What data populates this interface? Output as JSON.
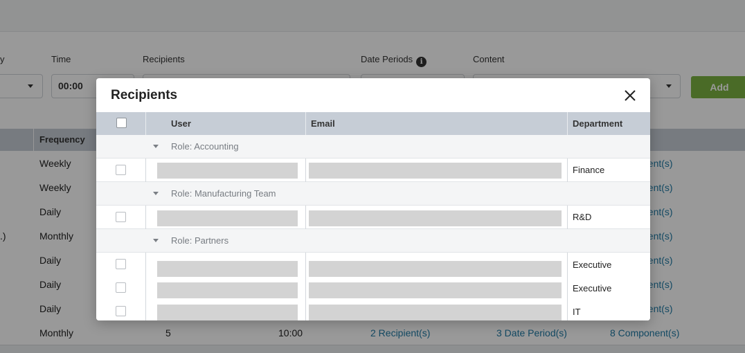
{
  "background": {
    "form": {
      "time_label": "Time",
      "time_value": "00:00",
      "recipients_label": "Recipients",
      "date_periods_label": "Date Periods",
      "info_glyph": "i",
      "content_label": "Content",
      "add_label": "Add"
    },
    "table": {
      "frequency_header": "Frequency",
      "rows": [
        {
          "frequency": "Weekly",
          "components": "nent(s)"
        },
        {
          "frequency": "Weekly",
          "components": "nent(s)"
        },
        {
          "frequency": "Daily",
          "components": "nent(s)"
        },
        {
          "left_fragment": ".)",
          "frequency": "Monthly",
          "components": "nent(s)"
        },
        {
          "frequency": "Daily",
          "components": "nent(s)"
        },
        {
          "frequency": "Daily",
          "components": "nent(s)"
        },
        {
          "frequency": "Daily",
          "components": "nent(s)"
        },
        {
          "frequency": "Monthly",
          "count": "5",
          "time": "10:00",
          "recipients": "2 Recipient(s)",
          "date_periods": "3 Date Period(s)",
          "components": "8 Component(s)"
        }
      ]
    }
  },
  "modal": {
    "title": "Recipients",
    "columns": {
      "user": "User",
      "email": "Email",
      "department": "Department"
    },
    "groups": [
      {
        "label": "Role: Accounting",
        "rows": [
          {
            "department": "Finance"
          }
        ]
      },
      {
        "label": "Role: Manufacturing Team",
        "rows": [
          {
            "department": "R&D"
          }
        ]
      },
      {
        "label": "Role: Partners",
        "rows": [
          {
            "department": "Executive"
          },
          {
            "department": "Executive"
          },
          {
            "department": "IT"
          }
        ]
      }
    ]
  },
  "colors": {
    "accent_link": "#1f7aa5",
    "add_button": "#7cb342",
    "header_bg": "#c6cdd6",
    "placeholder": "#d3d3d3"
  }
}
